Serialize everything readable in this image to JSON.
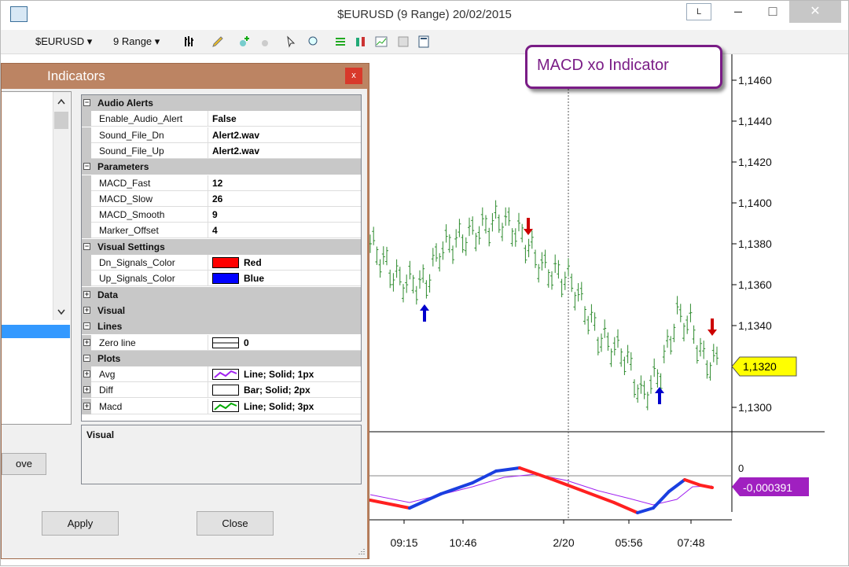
{
  "window": {
    "title": "$EURUSD (9 Range)  20/02/2015",
    "l_button": "L",
    "minimize": "–",
    "maximize": "□",
    "close": "✕"
  },
  "toolbar": {
    "instrument": "$EURUSD ▾",
    "period": "9 Range ▾"
  },
  "callout": "MACD xo Indicator",
  "indicators_dialog": {
    "title": "Indicators",
    "close": "x",
    "remove_label": "ove",
    "apply_label": "Apply",
    "close_label": "Close",
    "description_title": "Visual",
    "rows": [
      {
        "type": "category",
        "label": "Audio Alerts",
        "expanded": true
      },
      {
        "type": "prop",
        "label": "Enable_Audio_Alert",
        "value": "False"
      },
      {
        "type": "prop",
        "label": "Sound_File_Dn",
        "value": "Alert2.wav"
      },
      {
        "type": "prop",
        "label": "Sound_File_Up",
        "value": "Alert2.wav"
      },
      {
        "type": "category",
        "label": "Parameters",
        "expanded": true
      },
      {
        "type": "prop",
        "label": "MACD_Fast",
        "value": "12"
      },
      {
        "type": "prop",
        "label": "MACD_Slow",
        "value": "26"
      },
      {
        "type": "prop",
        "label": "MACD_Smooth",
        "value": "9"
      },
      {
        "type": "prop",
        "label": "Marker_Offset",
        "value": "4"
      },
      {
        "type": "category",
        "label": "Visual Settings",
        "expanded": true
      },
      {
        "type": "color",
        "label": "Dn_Signals_Color",
        "value": "Red",
        "color": "#ff0000"
      },
      {
        "type": "color",
        "label": "Up_Signals_Color",
        "value": "Blue",
        "color": "#0000ff"
      },
      {
        "type": "category",
        "label": "Data",
        "expanded": false
      },
      {
        "type": "category",
        "label": "Visual",
        "expanded": false
      },
      {
        "type": "category",
        "label": "Lines",
        "expanded": true
      },
      {
        "type": "line",
        "label": "Zero line",
        "value": "0"
      },
      {
        "type": "category",
        "label": "Plots",
        "expanded": true
      },
      {
        "type": "plot",
        "label": "Avg",
        "value": "Line; Solid; 1px",
        "swatch": "line",
        "color": "#a020f0"
      },
      {
        "type": "plot",
        "label": "Diff",
        "value": "Bar; Solid; 2px",
        "swatch": "bar",
        "color": "#000000"
      },
      {
        "type": "plot",
        "label": "Macd",
        "value": "Line; Solid; 3px",
        "swatch": "line",
        "color": "#00aa00"
      }
    ]
  },
  "chart": {
    "price_ticks": [
      "1,1460",
      "1,1440",
      "1,1420",
      "1,1400",
      "1,1380",
      "1,1360",
      "1,1340",
      "1,1320",
      "1,1300"
    ],
    "last_price": "1,1320",
    "macd_zero_label": "0",
    "macd_value": "-0,000391",
    "time_labels": [
      "09:15",
      "10:46",
      "2/20",
      "05:56",
      "07:48"
    ],
    "price_color": "#2e8b2e",
    "up_arrow_color": "#0000cc",
    "down_arrow_color": "#cc0000",
    "last_price_badge_color": "#ffff00",
    "macd_badge_color": "#a020c0"
  }
}
